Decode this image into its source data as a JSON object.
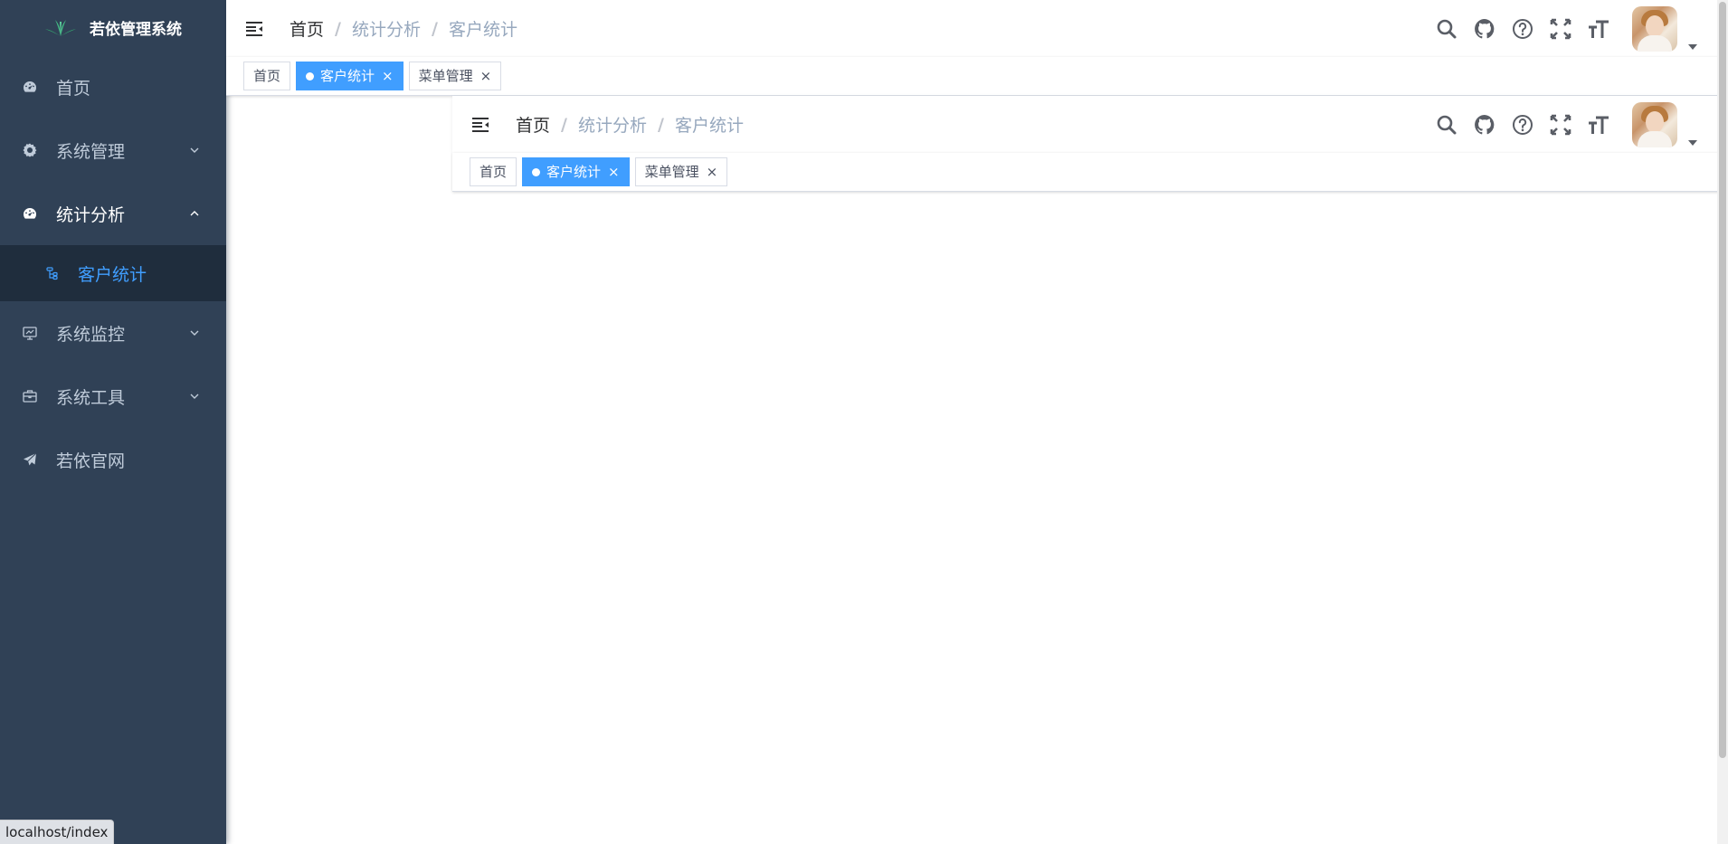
{
  "app": {
    "title": "若依管理系统",
    "colors": {
      "sidebar_bg": "#304156",
      "submenu_bg": "#1f2d3d",
      "accent": "#409eff",
      "sidebar_text": "#bfcbd9"
    }
  },
  "sidebar": {
    "items": [
      {
        "label": "首页",
        "icon": "dashboard-icon"
      },
      {
        "label": "系统管理",
        "icon": "gear-icon",
        "arrow": "chevron-down"
      },
      {
        "label": "统计分析",
        "icon": "dashboard-icon",
        "arrow": "chevron-up"
      },
      {
        "label": "客户统计",
        "icon": "tree-icon",
        "active": true
      },
      {
        "label": "系统监控",
        "icon": "monitor-icon",
        "arrow": "chevron-down"
      },
      {
        "label": "系统工具",
        "icon": "toolbox-icon",
        "arrow": "chevron-down"
      },
      {
        "label": "若依官网",
        "icon": "send-icon"
      }
    ]
  },
  "header": {
    "breadcrumb": [
      "首页",
      "统计分析",
      "客户统计"
    ],
    "separator": "/",
    "icons": [
      "search-icon",
      "github-icon",
      "question-icon",
      "fullscreen-icon",
      "font-size-icon"
    ]
  },
  "tags": [
    {
      "label": "首页"
    },
    {
      "label": "客户统计",
      "active": true,
      "close": "×"
    },
    {
      "label": "菜单管理",
      "close": "×"
    }
  ],
  "status_bar": {
    "url": "localhost/index"
  }
}
